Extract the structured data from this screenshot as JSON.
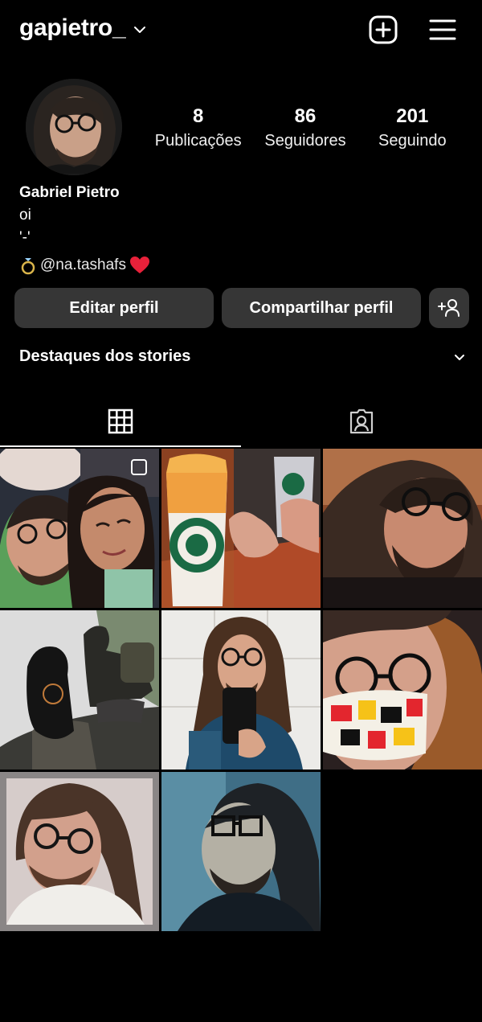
{
  "header": {
    "username": "gapietro_",
    "icons": [
      "create-post-icon",
      "menu-icon"
    ]
  },
  "profile": {
    "stats": [
      {
        "value": "8",
        "label": "Publicações"
      },
      {
        "value": "86",
        "label": "Seguidores"
      },
      {
        "value": "201",
        "label": "Seguindo"
      }
    ],
    "name": "Gabriel Pietro",
    "bio_lines": [
      "oi",
      "'-'"
    ],
    "mention": "@na.tashafs",
    "mention_emojis": [
      "ring",
      "red-heart"
    ]
  },
  "buttons": {
    "edit": "Editar perfil",
    "share": "Compartilhar perfil"
  },
  "highlights": {
    "title": "Destaques dos stories"
  },
  "tabs": [
    {
      "icon": "grid-icon",
      "active": true
    },
    {
      "icon": "tagged-icon",
      "active": false
    }
  ],
  "posts": [
    {
      "alt": "couple-selfie",
      "multi": true
    },
    {
      "alt": "starbucks-drinks",
      "multi": false
    },
    {
      "alt": "selfie-glasses",
      "multi": false
    },
    {
      "alt": "hiking-rock",
      "multi": false
    },
    {
      "alt": "mirror-selfie",
      "multi": false
    },
    {
      "alt": "mask-selfie",
      "multi": false
    },
    {
      "alt": "portrait-glasses",
      "multi": false
    },
    {
      "alt": "blue-tint-selfie",
      "multi": false
    }
  ],
  "colors": {
    "background": "#000000",
    "button_bg": "#363636",
    "heart": "#e8213a"
  }
}
